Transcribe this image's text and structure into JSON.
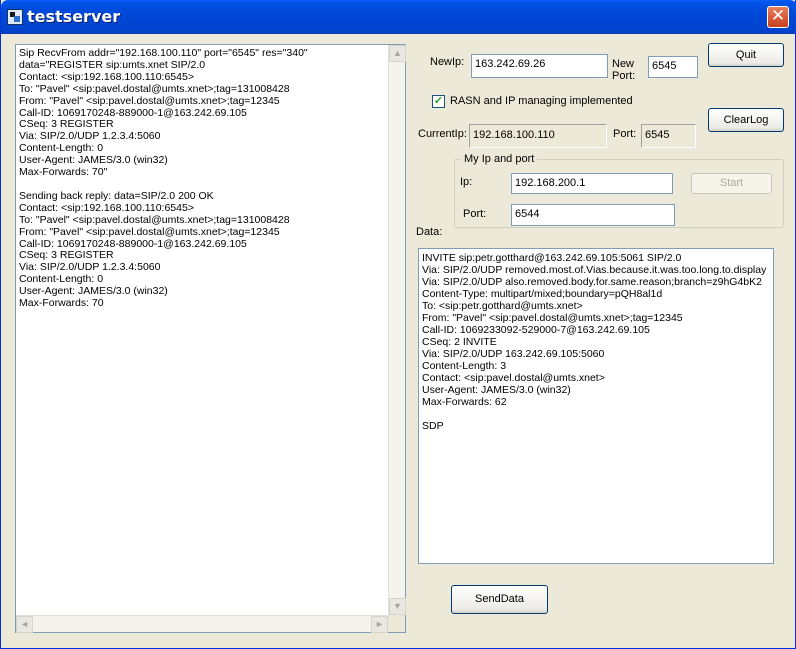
{
  "window": {
    "title": "testserver",
    "close_glyph": "✕"
  },
  "log": {
    "lines": "Sip RecvFrom addr=\"192.168.100.110\" port=\"6545\" res=\"340\"\ndata=\"REGISTER sip:umts.xnet SIP/2.0\nContact: <sip:192.168.100.110:6545>\nTo: \"Pavel\" <sip:pavel.dostal@umts.xnet>;tag=131008428\nFrom: \"Pavel\" <sip:pavel.dostal@umts.xnet>;tag=12345\nCall-ID: 1069170248-889000-1@163.242.69.105\nCSeq: 3 REGISTER\nVia: SIP/2.0/UDP 1.2.3.4:5060\nContent-Length: 0\nUser-Agent: JAMES/3.0 (win32)\nMax-Forwards: 70\"\n\nSending back reply: data=SIP/2.0 200 OK\nContact: <sip:192.168.100.110:6545>\nTo: \"Pavel\" <sip:pavel.dostal@umts.xnet>;tag=131008428\nFrom: \"Pavel\" <sip:pavel.dostal@umts.xnet>;tag=12345\nCall-ID: 1069170248-889000-1@163.242.69.105\nCSeq: 3 REGISTER\nVia: SIP/2.0/UDP 1.2.3.4:5060\nContent-Length: 0\nUser-Agent: JAMES/3.0 (win32)\nMax-Forwards: 70"
  },
  "scroll": {
    "up": "▲",
    "down": "▼",
    "left": "◄",
    "right": "►"
  },
  "new_ip": {
    "label": "NewIp:",
    "value": "163.242.69.26"
  },
  "new_port": {
    "label_line1": "New",
    "label_line2": "Port:",
    "value": "6545"
  },
  "quit_label": "Quit",
  "rasn": {
    "label": "RASN and IP managing implemented",
    "check_glyph": "✓",
    "checked": true
  },
  "clearlog_label": "ClearLog",
  "current_ip": {
    "label": "CurrentIp:",
    "value": "192.168.100.110"
  },
  "current_port": {
    "label": "Port:",
    "value": "6545"
  },
  "my_ip_group": {
    "title": "My Ip and port",
    "ip_label": "Ip:",
    "ip_value": "192.168.200.1",
    "port_label": "Port:",
    "port_value": "6544",
    "start_label": "Start"
  },
  "data_section": {
    "label": "Data:",
    "content": "INVITE sip:petr.gotthard@163.242.69.105:5061 SIP/2.0\nVia: SIP/2.0/UDP removed.most.of.Vias.because.it.was.too.long.to.display\nVia: SIP/2.0/UDP also.removed.body.for.same.reason;branch=z9hG4bK2\nContent-Type: multipart/mixed;boundary=pQH8al1d\nTo: <sip:petr.gotthard@umts.xnet>\nFrom: \"Pavel\" <sip:pavel.dostal@umts.xnet>;tag=12345\nCall-ID: 1069233092-529000-7@163.242.69.105\nCSeq: 2 INVITE\nVia: SIP/2.0/UDP 163.242.69.105:5060\nContent-Length: 3\nContact: <sip:pavel.dostal@umts.xnet>\nUser-Agent: JAMES/3.0 (win32)\nMax-Forwards: 62\n\nSDP"
  },
  "senddata_label": "SendData"
}
